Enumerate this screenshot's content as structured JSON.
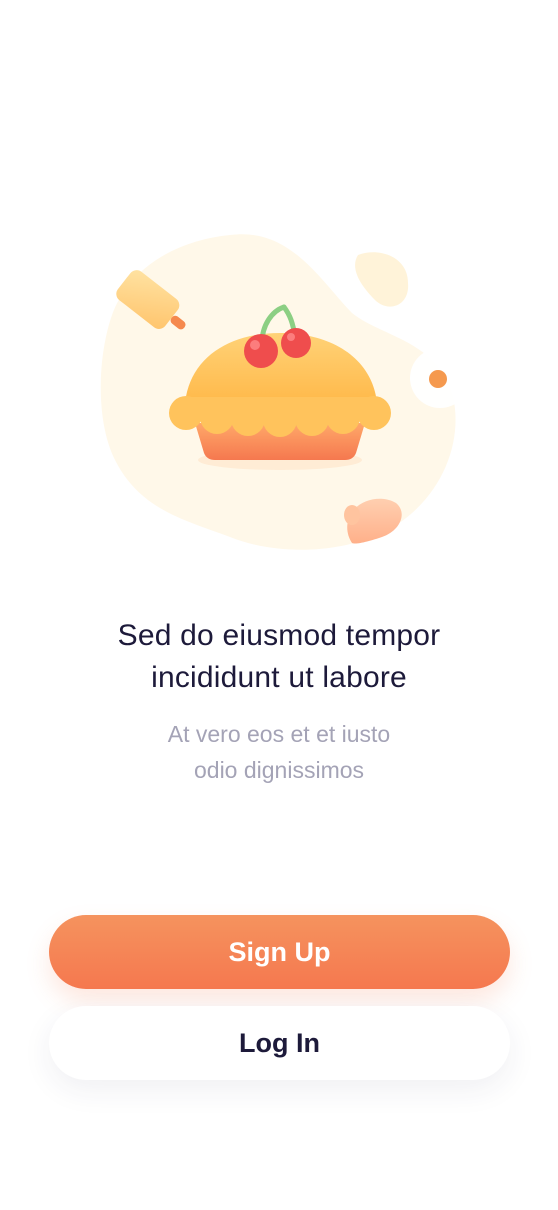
{
  "illustration": {
    "subject": "cherry-pie-icon",
    "decorations": [
      "rolling-pin-icon",
      "fried-egg-icon",
      "oven-mitt-icon"
    ]
  },
  "headline": {
    "line1": "Sed do eiusmod tempor",
    "line2": "incididunt ut labore"
  },
  "subtext": {
    "line1": "At vero eos et et iusto",
    "line2": "odio dignissimos"
  },
  "actions": {
    "signup_label": "Sign Up",
    "login_label": "Log In"
  },
  "colors": {
    "accent": "#f5784f",
    "heading": "#1d1a3a",
    "muted": "#a4a3b6",
    "blob": "#fff8e9"
  }
}
